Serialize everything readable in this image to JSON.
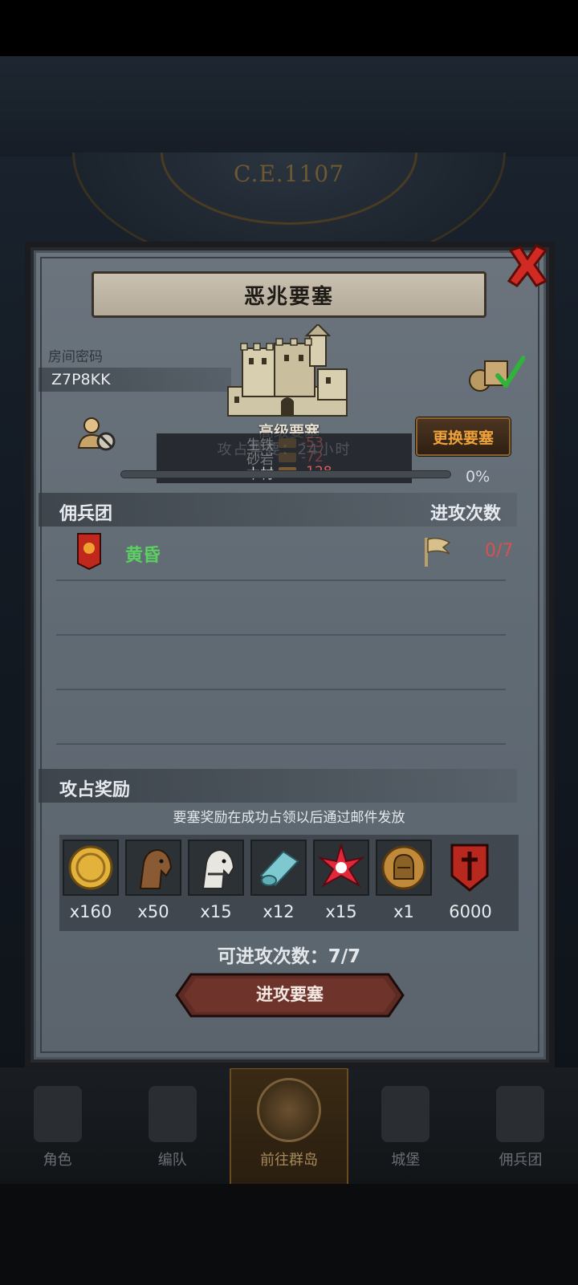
{
  "background": {
    "year": "C.E.1107"
  },
  "dialog": {
    "title": "恶兆要塞",
    "room_label": "房间密码",
    "room_code": "Z7P8KK",
    "fortress_name": "高级要塞",
    "change_button": "更换要塞",
    "resources": [
      {
        "label": "生铁",
        "value": "-53"
      },
      {
        "label": "砂岩",
        "value": "-72"
      },
      {
        "label": "木材",
        "value": "-128"
      }
    ],
    "occupy_overlay": "攻占需要：24小时",
    "progress": {
      "value_percent": 0,
      "text": "0%"
    },
    "mercenary_header": {
      "left": "佣兵团",
      "right": "进攻次数"
    },
    "guild": {
      "name": "黄昏",
      "attacks": "0/7"
    },
    "reward_header": "攻占奖励",
    "reward_note": "要塞奖励在成功占领以后通过邮件发放",
    "rewards": [
      {
        "icon": "gold-coin-icon",
        "qty": "x160"
      },
      {
        "icon": "brown-horse-icon",
        "qty": "x50"
      },
      {
        "icon": "white-horse-icon",
        "qty": "x15"
      },
      {
        "icon": "cloth-roll-icon",
        "qty": "x12"
      },
      {
        "icon": "red-star-gem-icon",
        "qty": "x15"
      },
      {
        "icon": "helmet-medal-icon",
        "qty": "x1"
      },
      {
        "icon": "red-shield-banner-icon",
        "qty": "6000"
      }
    ],
    "attempts_text": "可进攻次数：7/7",
    "attack_button": "进攻要塞"
  },
  "bottom_nav": [
    {
      "label": "角色"
    },
    {
      "label": "编队"
    },
    {
      "label": "前往群岛",
      "active": true
    },
    {
      "label": "城堡"
    },
    {
      "label": "佣兵团"
    }
  ],
  "colors": {
    "danger": "#d4534f",
    "guild_green": "#5bd060",
    "button_orange": "#f0a23a"
  }
}
